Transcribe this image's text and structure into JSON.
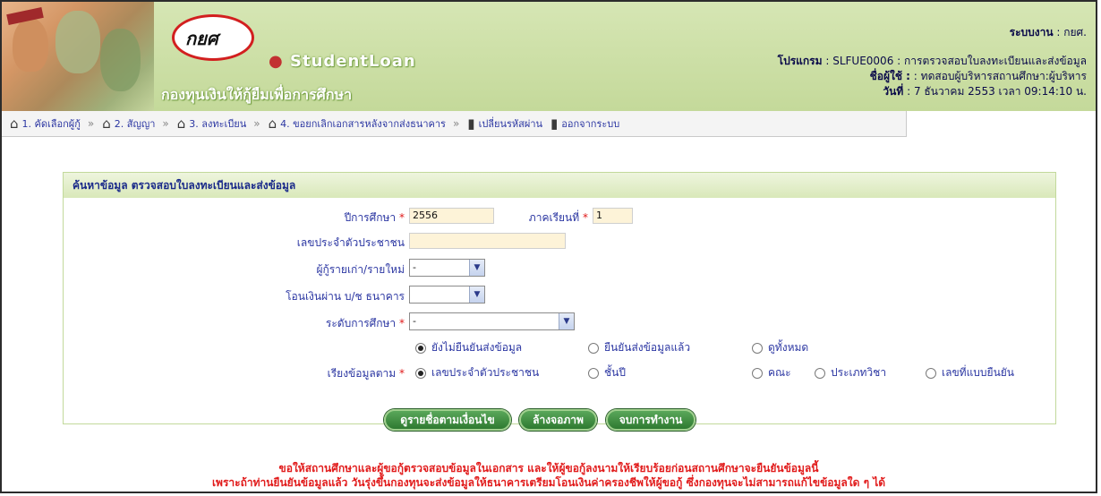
{
  "header": {
    "logo_text": "กยศ",
    "brand_en": "StudentLoan",
    "brand_th": "กองทุนเงินให้กู้ยืมเพื่อการศึกษา",
    "system_label": "ระบบงาน",
    "system_value": ": กยศ.",
    "program_label": "โปรแกรม",
    "program_value": ": SLFUE0006 : การตรวจสอบใบลงทะเบียนและส่งข้อมูล",
    "user_label": "ชื่อผู้ใช้ :",
    "user_value": ": ทดสอบผู้บริหารสถานศึกษา:ผู้บริหาร",
    "date_label": "วันที่",
    "date_value": ": 7 ธันวาคม 2553 เวลา 09:14:10 น."
  },
  "nav": {
    "items": [
      {
        "label": "1. คัดเลือกผู้กู้",
        "icon": "home-icon"
      },
      {
        "label": "2. สัญญา",
        "icon": "home-icon"
      },
      {
        "label": "3. ลงทะเบียน",
        "icon": "home-icon"
      },
      {
        "label": "4. ขอยกเลิกเอกสารหลังจากส่งธนาคาร",
        "icon": "home-icon"
      },
      {
        "label": "เปลี่ยนรหัสผ่าน",
        "icon": "door-icon"
      },
      {
        "label": "ออกจากระบบ",
        "icon": "door-icon"
      }
    ],
    "separator": "»"
  },
  "form": {
    "title": "ค้นหาข้อมูล ตรวจสอบใบลงทะเบียนและส่งข้อมูล",
    "academic_year_label": "ปีการศึกษา",
    "academic_year_value": "2556",
    "semester_label": "ภาคเรียนที่",
    "semester_value": "1",
    "citizen_id_label": "เลขประจำตัวประชาชน",
    "citizen_id_value": "",
    "borrower_type_label": "ผู้กู้รายเก่า/รายใหม่",
    "borrower_type_value": "-",
    "transfer_label": "โอนเงินผ่าน บ/ช ธนาคาร",
    "transfer_value": "",
    "edu_level_label": "ระดับการศึกษา",
    "edu_level_value": "-",
    "required_mark": "*",
    "status_options": [
      "ยังไม่ยืนยันส่งข้อมูล",
      "ยืนยันส่งข้อมูลแล้ว",
      "ดูทั้งหมด"
    ],
    "status_selected": 0,
    "sort_label": "เรียงข้อมูลตาม",
    "sort_options": [
      "เลขประจำตัวประชาชน",
      "ชั้นปี",
      "คณะ",
      "ประเภทวิชา",
      "เลขที่แบบยืนยัน"
    ],
    "sort_selected": 0
  },
  "buttons": {
    "search": "ดูรายชื่อตามเงื่อนไข",
    "clear": "ล้างจอภาพ",
    "finish": "จบการทำงาน"
  },
  "notice": {
    "line1": "ขอให้สถานศึกษาและผู้ขอกู้ตรวจสอบข้อมูลในเอกสาร และให้ผู้ขอกู้ลงนามให้เรียบร้อยก่อนสถานศึกษาจะยืนยันข้อมูลนี้",
    "line2": "เพราะถ้าท่านยืนยันข้อมูลแล้ว วันรุ่งขึ้นกองทุนจะส่งข้อมูลให้ธนาคารเตรียมโอนเงินค่าครองชีพให้ผู้ขอกู้ ซึ่งกองทุนจะไม่สามารถแก้ไขข้อมูลใด ๆ ได้"
  },
  "colors": {
    "header_bg": "#c4d99a",
    "panel_title_bg": "#d9e8b9",
    "button_green": "#2e7a31",
    "notice_red": "#e11c1c",
    "label_blue": "#2b36a2"
  }
}
